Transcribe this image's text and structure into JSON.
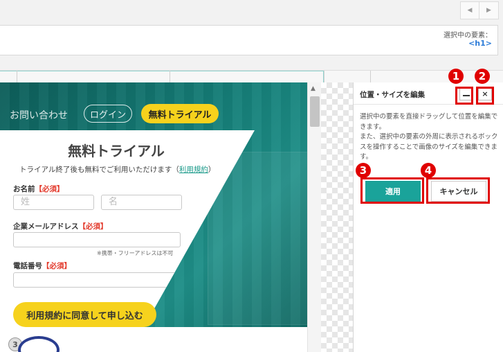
{
  "top_nav": {
    "prev_icon": "chevron-left-icon",
    "next_icon": "chevron-right-icon",
    "prev_glyph": "◀",
    "next_glyph": "▶"
  },
  "selection_info": {
    "label": "選択中の要素：",
    "value": "<h1>"
  },
  "preview": {
    "header": {
      "contact": "お問い合わせ",
      "login": "ログイン",
      "trial": "無料トライアル"
    },
    "form": {
      "title": "無料トライアル",
      "note_text": "トライアル終了後も無料でご利用いただけます",
      "note_open": "（",
      "note_link": "利用規約",
      "note_close": "）",
      "required_tag": "【必須】",
      "name_label": "お名前",
      "last_name_placeholder": "姓",
      "first_name_placeholder": "名",
      "email_label": "企業メールアドレス",
      "email_hint": "※携帯・フリーアドレスは不可",
      "phone_label": "電話番号",
      "submit": "利用規約に同意して申し込む"
    },
    "badge_number": "3"
  },
  "scrollbar": {
    "up_glyph": "▲"
  },
  "edit_panel": {
    "title": "位置・サイズを編集",
    "close_glyph": "×",
    "description": "選択中の要素を直接ドラッグして位置を編集できます。\nまた、選択中の要素の外周に表示されるボックスを操作することで画像のサイズを編集できます。",
    "apply": "適用",
    "cancel": "キャンセル"
  },
  "annotations": [
    "1",
    "2",
    "3",
    "4"
  ],
  "colors": {
    "accent_teal": "#1aa39a",
    "highlight_red": "#e00000",
    "cta_yellow": "#f6d21d",
    "link_blue": "#2b7bd8"
  }
}
